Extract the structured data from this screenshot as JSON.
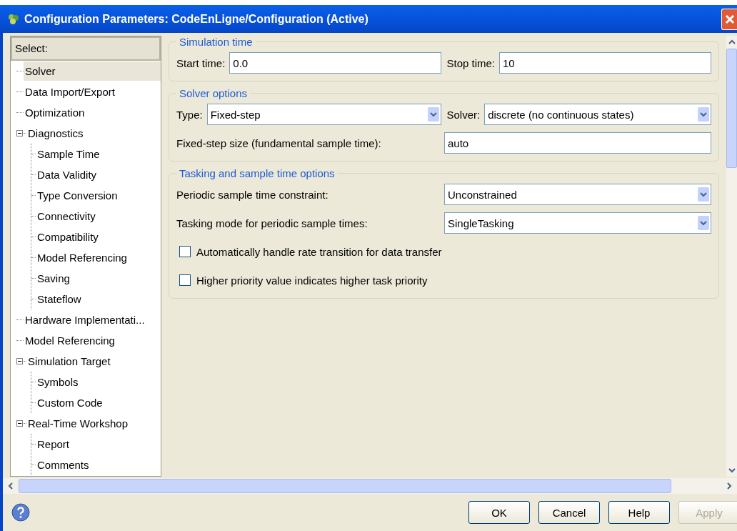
{
  "window": {
    "title": "Configuration Parameters: CodeEnLigne/Configuration (Active)"
  },
  "tree": {
    "header": "Select:",
    "items": [
      {
        "label": "Solver",
        "selected": true
      },
      {
        "label": "Data Import/Export",
        "selected": false
      },
      {
        "label": "Optimization",
        "selected": false
      },
      {
        "label": "Diagnostics",
        "selected": false,
        "expanded": true,
        "children": [
          {
            "label": "Sample Time",
            "selected": false
          },
          {
            "label": "Data Validity",
            "selected": false
          },
          {
            "label": "Type Conversion",
            "selected": false
          },
          {
            "label": "Connectivity",
            "selected": false
          },
          {
            "label": "Compatibility",
            "selected": false
          },
          {
            "label": "Model Referencing",
            "selected": false
          },
          {
            "label": "Saving",
            "selected": false
          },
          {
            "label": "Stateflow",
            "selected": false
          }
        ]
      },
      {
        "label": "Hardware Implementati...",
        "selected": false
      },
      {
        "label": "Model Referencing",
        "selected": false
      },
      {
        "label": "Simulation Target",
        "selected": false,
        "expanded": true,
        "children": [
          {
            "label": "Symbols",
            "selected": false
          },
          {
            "label": "Custom Code",
            "selected": false
          }
        ]
      },
      {
        "label": "Real-Time Workshop",
        "selected": false,
        "expanded": true,
        "children": [
          {
            "label": "Report",
            "selected": false
          },
          {
            "label": "Comments",
            "selected": false
          }
        ]
      }
    ]
  },
  "sections": [
    {
      "title": "Simulation time",
      "rows": [
        [
          {
            "kind": "text",
            "label": "Start time:",
            "value": "0.0"
          },
          {
            "kind": "text",
            "label": "Stop time:",
            "value": "10"
          }
        ]
      ]
    },
    {
      "title": "Solver options",
      "rows": [
        [
          {
            "kind": "dropdown",
            "label": "Type:",
            "value": "Fixed-step"
          },
          {
            "kind": "dropdown",
            "label": "Solver:",
            "value": "discrete (no continuous states)"
          }
        ],
        [
          {
            "kind": "text",
            "label": "Fixed-step size (fundamental sample time):",
            "value": "auto"
          }
        ]
      ]
    },
    {
      "title": "Tasking and sample time options",
      "rows": [
        [
          {
            "kind": "dropdown",
            "label": "Periodic sample time constraint:",
            "value": "Unconstrained"
          }
        ],
        [
          {
            "kind": "dropdown",
            "label": "Tasking mode for periodic sample times:",
            "value": "SingleTasking"
          }
        ],
        [
          {
            "kind": "checkbox",
            "label": "Automatically handle rate transition for data transfer",
            "checked": false
          }
        ],
        [
          {
            "kind": "checkbox",
            "label": "Higher priority value indicates higher task priority",
            "checked": false
          }
        ]
      ]
    }
  ],
  "buttons": [
    {
      "label": "OK",
      "disabled": false
    },
    {
      "label": "Cancel",
      "disabled": false
    },
    {
      "label": "Help",
      "disabled": false
    },
    {
      "label": "Apply",
      "disabled": true
    }
  ]
}
